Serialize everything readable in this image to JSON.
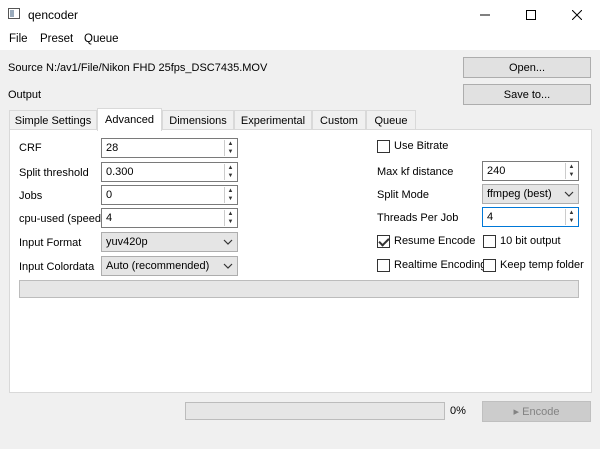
{
  "window": {
    "title": "qencoder"
  },
  "menu": [
    "File",
    "Preset",
    "Queue"
  ],
  "source": {
    "label": "Source",
    "path": "N:/av1/File/Nikon FHD 25fps_DSC7435.MOV"
  },
  "output": {
    "label": "Output",
    "path": ""
  },
  "buttons": {
    "open": "Open...",
    "save": "Save to...",
    "encode": "▸ Encode"
  },
  "tabs": [
    "Simple Settings",
    "Advanced",
    "Dimensions",
    "Experimental",
    "Custom",
    "Queue"
  ],
  "active_tab": "Advanced",
  "left_fields": {
    "crf": {
      "label": "CRF",
      "value": "28"
    },
    "split": {
      "label": "Split threshold",
      "value": "0.300"
    },
    "jobs": {
      "label": "Jobs",
      "value": "0"
    },
    "cpu": {
      "label": "cpu-used (speed)",
      "value": "4"
    },
    "input_format": {
      "label": "Input Format",
      "value": "yuv420p"
    },
    "colordata": {
      "label": "Input Colordata",
      "value": "Auto (recommended)"
    }
  },
  "right_fields": {
    "use_bitrate": {
      "label": "Use Bitrate",
      "checked": false
    },
    "max_kf": {
      "label": "Max kf distance",
      "value": "240"
    },
    "split_mode": {
      "label": "Split Mode",
      "value": "ffmpeg (best)"
    },
    "threads": {
      "label": "Threads Per Job",
      "value": "4"
    },
    "resume": {
      "label": "Resume Encode",
      "checked": true
    },
    "ten_bit": {
      "label": "10 bit output",
      "checked": false
    },
    "realtime": {
      "label": "Realtime Encoding",
      "checked": false
    },
    "keep_temp": {
      "label": "Keep temp folder",
      "checked": false
    }
  },
  "progress": {
    "tab_progress": 0,
    "overall_progress": 0,
    "percent_label": "0%"
  },
  "icons": {
    "minimize": "minimize-icon",
    "maximize": "maximize-icon",
    "close": "close-icon",
    "play": "play-icon"
  }
}
